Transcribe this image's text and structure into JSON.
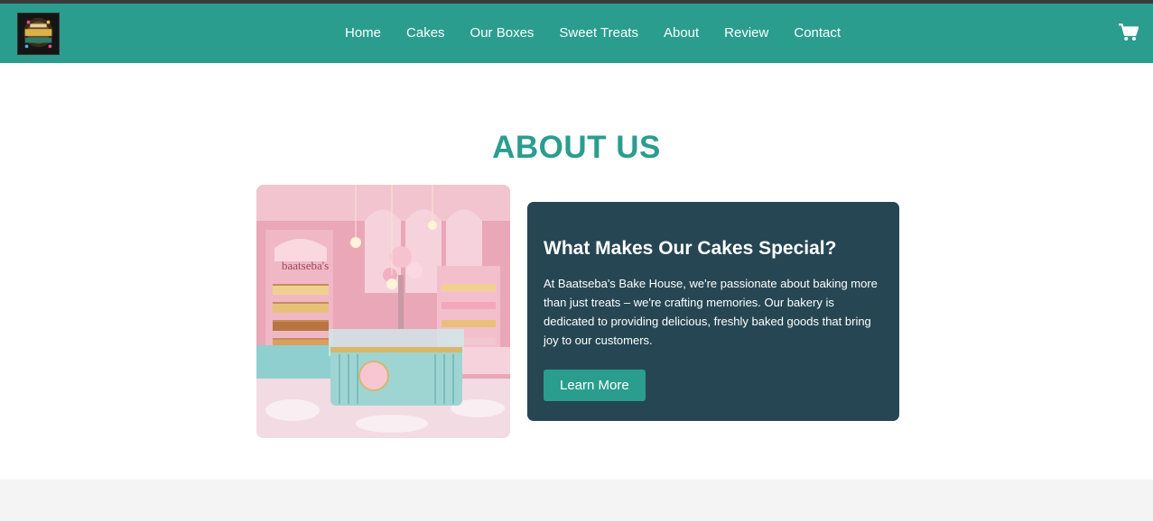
{
  "nav": {
    "logo_alt": "Baatseba's Bake House logo",
    "links": [
      {
        "label": "Home"
      },
      {
        "label": "Cakes"
      },
      {
        "label": "Our Boxes"
      },
      {
        "label": "Sweet Treats"
      },
      {
        "label": "About"
      },
      {
        "label": "Review"
      },
      {
        "label": "Contact"
      }
    ],
    "cart_icon": "shopping-cart-icon"
  },
  "about": {
    "title": "ABOUT US",
    "image_sign_text": "baatseba's",
    "card": {
      "heading": "What Makes Our Cakes Special?",
      "body": "At Baatseba's Bake House, we're passionate about baking more than just treats – we're crafting memories. Our bakery is dedicated to providing delicious, freshly baked goods that bring joy to our customers.",
      "button_label": "Learn More"
    }
  },
  "colors": {
    "brand_teal": "#2a9d8f",
    "card_dark": "#264653",
    "footer_gray": "#f4f4f4"
  }
}
